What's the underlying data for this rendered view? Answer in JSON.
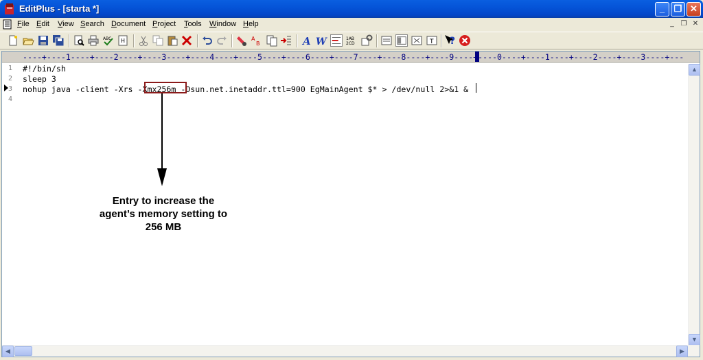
{
  "window": {
    "title": "EditPlus - [starta *]",
    "title_bar_color": "#0a5fe0",
    "minimize_label": "_",
    "maximize_label": "❐",
    "close_label": "✕"
  },
  "menu": {
    "items": [
      "File",
      "Edit",
      "View",
      "Search",
      "Document",
      "Project",
      "Tools",
      "Window",
      "Help"
    ],
    "mdi_minimize": "_",
    "mdi_restore": "❐",
    "mdi_close": "✕"
  },
  "toolbar": {
    "icons": [
      "new-file-icon",
      "open-folder-icon",
      "save-icon",
      "save-all-icon",
      "print-preview-icon",
      "print-icon",
      "spell-check-icon",
      "document-icon",
      "cut-icon",
      "copy-icon",
      "paste-icon",
      "delete-icon",
      "undo-icon",
      "redo-icon",
      "find-icon",
      "replace-icon",
      "find-in-files-icon",
      "goto-icon",
      "font-icon",
      "word-wrap-icon",
      "line-wrap-icon",
      "line-number-icon",
      "settings-icon",
      "window-icon",
      "browser-icon",
      "clip-icon",
      "user-tool-icon",
      "help-icon",
      "stop-icon"
    ]
  },
  "ruler": {
    "text": "----+----1----+----2----+----3----+----4----+----5----+----6----+----7----+----8----+----9----+----0----+----1----+----2----+----3----+---"
  },
  "editor": {
    "line_numbers": [
      "1",
      "2",
      "3",
      "4"
    ],
    "lines": [
      "#!/bin/sh",
      "sleep 3",
      "nohup java -client -Xrs -Xmx256m -Dsun.net.inetaddr.ttl=900 EgMainAgent $* > /dev/null 2>&1 &",
      ""
    ]
  },
  "annotation": {
    "text_lines": [
      "Entry to increase the",
      "agent’s memory setting to",
      "256 MB"
    ],
    "highlight_color": "#8b1a1a"
  }
}
